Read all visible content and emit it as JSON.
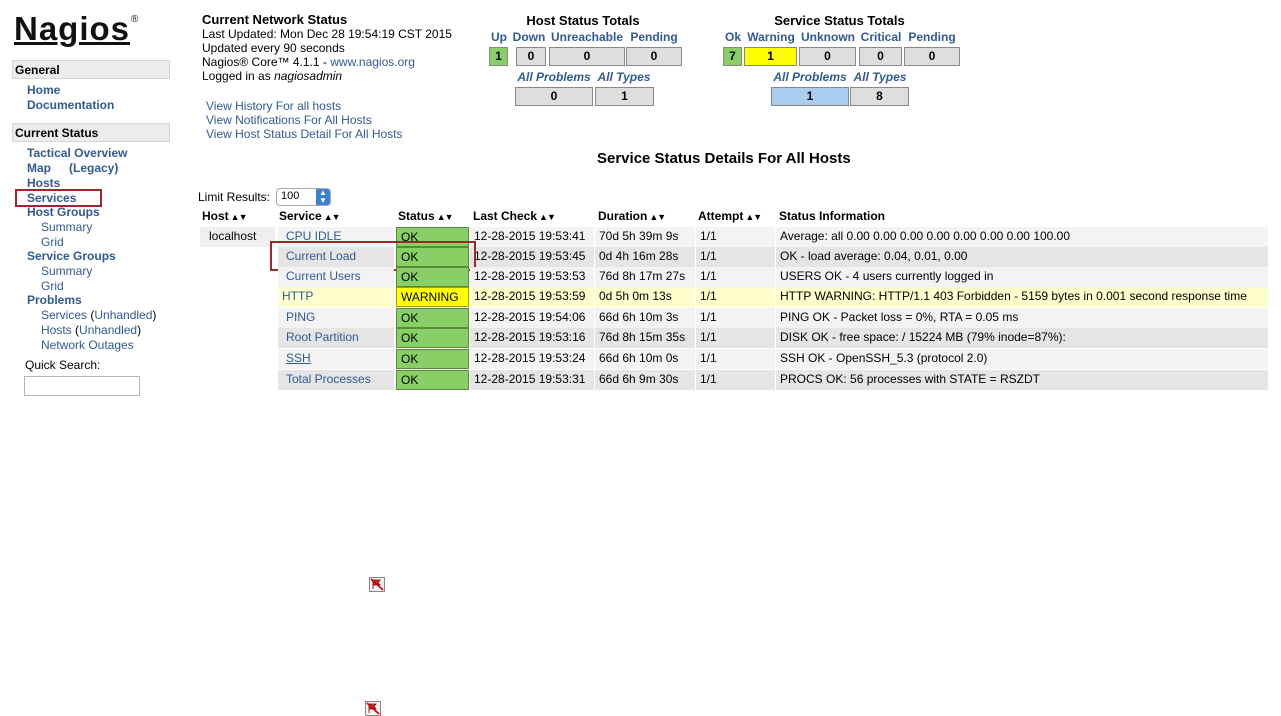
{
  "logo": {
    "text": "Nagios",
    "reg": "®"
  },
  "sidebar": {
    "general": "General",
    "home": "Home",
    "documentation": "Documentation",
    "current_status": "Current Status",
    "tactical": "Tactical Overview",
    "map": "Map",
    "map_legacy": "(Legacy)",
    "hosts": "Hosts",
    "services": "Services",
    "host_groups": "Host Groups",
    "hg_summary": "Summary",
    "hg_grid": "Grid",
    "service_groups": "Service Groups",
    "sg_summary": "Summary",
    "sg_grid": "Grid",
    "problems": "Problems",
    "prob_services": "Services",
    "prob_services_unhandled": "Unhandled",
    "prob_hosts": "Hosts",
    "prob_hosts_unhandled": "Unhandled",
    "network_outages": "Network Outages",
    "quick_search": "Quick Search:",
    "quick_search_value": ""
  },
  "info": {
    "title": "Current Network Status",
    "last_updated": "Last Updated: Mon Dec 28 19:54:19 CST 2015",
    "update_interval": "Updated every 90 seconds",
    "version_prefix": "Nagios® Core™ 4.1.1 - ",
    "version_link": "www.nagios.org",
    "logged_prefix": "Logged in as ",
    "user": "nagiosadmin"
  },
  "view_links": [
    "View History For all hosts",
    "View Notifications For All Hosts",
    "View Host Status Detail For All Hosts"
  ],
  "host_totals": {
    "title": "Host Status Totals",
    "headers": [
      "Up",
      "Down",
      "Unreachable",
      "Pending"
    ],
    "values": [
      "1",
      "0",
      "0",
      "0"
    ],
    "sub_headers": [
      "All Problems",
      "All Types"
    ],
    "sub_values": [
      "0",
      "1"
    ]
  },
  "service_totals": {
    "title": "Service Status Totals",
    "headers": [
      "Ok",
      "Warning",
      "Unknown",
      "Critical",
      "Pending"
    ],
    "values": [
      "7",
      "1",
      "0",
      "0",
      "0"
    ],
    "sub_headers": [
      "All Problems",
      "All Types"
    ],
    "sub_values": [
      "1",
      "8"
    ]
  },
  "main": {
    "title": "Service Status Details For All Hosts",
    "limit_label": "Limit Results:",
    "limit_value": "100"
  },
  "table": {
    "headers": [
      "Host",
      "Service",
      "Status",
      "Last Check",
      "Duration",
      "Attempt",
      "Status Information"
    ],
    "rows": [
      {
        "host": "localhost",
        "service": "CPU IDLE",
        "status": "OK",
        "last_check": "12-28-2015 19:53:41",
        "duration": "70d 5h 39m 9s",
        "attempt": "1/1",
        "info": "Average: all 0.00 0.00 0.00 0.00 0.00 0.00 0.00 100.00"
      },
      {
        "host": "",
        "service": "Current Load",
        "status": "OK",
        "last_check": "12-28-2015 19:53:45",
        "duration": "0d 4h 16m 28s",
        "attempt": "1/1",
        "info": "OK - load average: 0.04, 0.01, 0.00"
      },
      {
        "host": "",
        "service": "Current Users",
        "status": "OK",
        "last_check": "12-28-2015 19:53:53",
        "duration": "76d 8h 17m 27s",
        "attempt": "1/1",
        "info": "USERS OK - 4 users currently logged in"
      },
      {
        "host": "",
        "service": "HTTP",
        "status": "WARNING",
        "last_check": "12-28-2015 19:53:59",
        "duration": "0d 5h 0m 13s",
        "attempt": "1/1",
        "info": "HTTP WARNING: HTTP/1.1 403 Forbidden - 5159 bytes in 0.001 second response time"
      },
      {
        "host": "",
        "service": "PING",
        "status": "OK",
        "last_check": "12-28-2015 19:54:06",
        "duration": "66d 6h 10m 3s",
        "attempt": "1/1",
        "info": "PING OK - Packet loss = 0%, RTA = 0.05 ms"
      },
      {
        "host": "",
        "service": "Root Partition",
        "status": "OK",
        "last_check": "12-28-2015 19:53:16",
        "duration": "76d 8h 15m 35s",
        "attempt": "1/1",
        "info": "DISK OK - free space: / 15224 MB (79% inode=87%):"
      },
      {
        "host": "",
        "service": "SSH",
        "status": "OK",
        "last_check": "12-28-2015 19:53:24",
        "duration": "66d 6h 10m 0s",
        "attempt": "1/1",
        "info": "SSH OK - OpenSSH_5.3 (protocol 2.0)"
      },
      {
        "host": "",
        "service": "Total Processes",
        "status": "OK",
        "last_check": "12-28-2015 19:53:31",
        "duration": "66d 6h 9m 30s",
        "attempt": "1/1",
        "info": "PROCS OK: 56 processes with STATE = RSZDT"
      }
    ]
  },
  "colors": {
    "ok": "#88d066",
    "warning": "#ffff00",
    "link": "#315a90",
    "highlight": "#9a2a2a"
  },
  "icons": {
    "flap": "notifications-disabled-icon",
    "sort": "sort-arrows-icon"
  }
}
